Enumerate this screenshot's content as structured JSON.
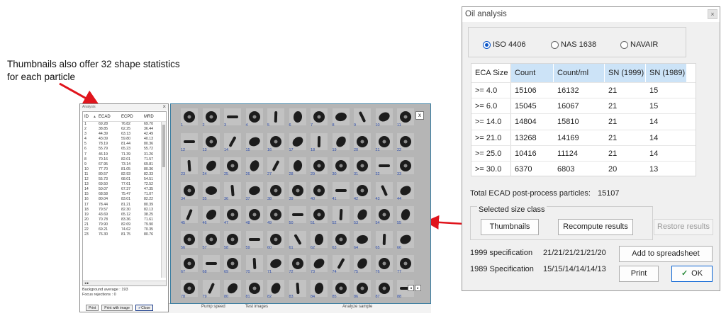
{
  "annotation": {
    "text": "Thumbnails also offer 32 shape statistics for each particle"
  },
  "stats_window": {
    "title": "Analysis",
    "close_glyph": "×",
    "columns": [
      "ID",
      "ECAD",
      "ECPD",
      "MRD"
    ],
    "rows": [
      [
        "1",
        "69.28",
        "76.82",
        "69.70"
      ],
      [
        "2",
        "38.85",
        "62.25",
        "36.44"
      ],
      [
        "3",
        "44.39",
        "63.13",
        "42.49"
      ],
      [
        "4",
        "43.09",
        "59.80",
        "40.13"
      ],
      [
        "5",
        "78.19",
        "81.44",
        "80.36"
      ],
      [
        "6",
        "55.79",
        "65.23",
        "55.72"
      ],
      [
        "7",
        "46.19",
        "71.39",
        "31.26"
      ],
      [
        "8",
        "70.16",
        "82.01",
        "71.57"
      ],
      [
        "9",
        "67.95",
        "73.14",
        "69.81"
      ],
      [
        "10",
        "77.70",
        "81.05",
        "80.36"
      ],
      [
        "11",
        "80.57",
        "82.93",
        "82.33"
      ],
      [
        "12",
        "55.73",
        "68.01",
        "54.51"
      ],
      [
        "13",
        "69.50",
        "77.61",
        "72.52"
      ],
      [
        "14",
        "50.07",
        "67.37",
        "47.35"
      ],
      [
        "15",
        "68.58",
        "75.47",
        "71.07"
      ],
      [
        "16",
        "80.04",
        "83.01",
        "82.22"
      ],
      [
        "17",
        "78.44",
        "81.21",
        "80.39"
      ],
      [
        "18",
        "79.57",
        "82.30",
        "82.13"
      ],
      [
        "19",
        "43.69",
        "65.12",
        "38.25"
      ],
      [
        "20",
        "70.78",
        "83.36",
        "71.61"
      ],
      [
        "21",
        "79.90",
        "82.69",
        "79.90"
      ],
      [
        "22",
        "69.21",
        "74.62",
        "70.35"
      ],
      [
        "23",
        "76.30",
        "81.75",
        "80.76"
      ]
    ],
    "background_average": "Background average : 193",
    "focus_rejections": "Focus rejections : 0",
    "print_label": "Print",
    "print_image_label": "Print with image",
    "close_label": "Close"
  },
  "bottom_strip": {
    "pump_speed": "Pump speed",
    "test_images": "Test images",
    "analyze_sample": "Analyze sample"
  },
  "thumbnails": {
    "close_glyph": "x",
    "numbers": [
      "1",
      "2",
      "3",
      "4",
      "5",
      "6",
      "7",
      "8",
      "9",
      "10",
      "11",
      "12",
      "13",
      "14",
      "15",
      "16",
      "17",
      "18",
      "19",
      "20",
      "21",
      "22",
      "23",
      "24",
      "25",
      "26",
      "27",
      "28",
      "29",
      "30",
      "31",
      "32",
      "33",
      "34",
      "35",
      "36",
      "37",
      "38",
      "39",
      "40",
      "41",
      "42",
      "43",
      "44",
      "45",
      "46",
      "47",
      "48",
      "49",
      "50",
      "51",
      "52",
      "53",
      "54",
      "55",
      "56",
      "57",
      "58",
      "59",
      "60",
      "61",
      "62",
      "63",
      "64",
      "65",
      "66",
      "67",
      "68",
      "69",
      "70",
      "71",
      "72",
      "73",
      "74",
      "75",
      "76",
      "77",
      "78",
      "79",
      "80",
      "81",
      "82",
      "83",
      "84",
      "85",
      "86",
      "87",
      "88"
    ]
  },
  "oil_dialog": {
    "title": "Oil analysis",
    "close_glyph": "×",
    "radios": [
      {
        "label": "ISO 4406",
        "selected": true
      },
      {
        "label": "NAS 1638",
        "selected": false
      },
      {
        "label": "NAVAIR",
        "selected": false
      }
    ],
    "table": {
      "headers": [
        "ECA Size",
        "Count",
        "Count/ml",
        "SN (1999)",
        "SN (1989)"
      ],
      "rows": [
        [
          ">= 4.0",
          "15106",
          "16132",
          "21",
          "15"
        ],
        [
          ">= 6.0",
          "15045",
          "16067",
          "21",
          "15"
        ],
        [
          ">= 14.0",
          "14804",
          "15810",
          "21",
          "14"
        ],
        [
          ">= 21.0",
          "13268",
          "14169",
          "21",
          "14"
        ],
        [
          ">= 25.0",
          "10416",
          "11124",
          "21",
          "14"
        ],
        [
          ">= 30.0",
          "6370",
          "6803",
          "20",
          "13"
        ]
      ]
    },
    "total_label": "Total ECAD post-process particles:",
    "total_value": "15107",
    "size_class_label": "Selected size class",
    "thumbnails_btn": "Thumbnails",
    "recompute_btn": "Recompute results",
    "restore_btn": "Restore results",
    "spec_1999_label": "1999 specification",
    "spec_1999_value": "21/21/21/21/21/20",
    "spec_1989_label": "1989 Specification",
    "spec_1989_value": "15/15/14/14/14/13",
    "add_btn": "Add to spreadsheet",
    "print_btn": "Print",
    "ok_btn": "OK"
  }
}
